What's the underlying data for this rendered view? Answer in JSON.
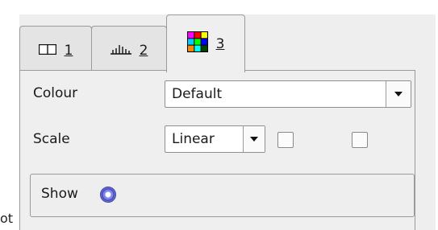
{
  "stray_text": "ot",
  "tabs": [
    {
      "label": "1",
      "icon": "panel-layout-icon"
    },
    {
      "label": "2",
      "icon": "histogram-icon"
    },
    {
      "label": "3",
      "icon": "color-grid-icon",
      "selected": true
    }
  ],
  "colour": {
    "label": "Colour",
    "value": "Default"
  },
  "scale": {
    "label": "Scale",
    "value": "Linear",
    "checkbox_1_checked": false,
    "checkbox_2_checked": false
  },
  "show": {
    "label": "Show",
    "selected": true
  },
  "colors": {
    "grid": [
      "#ff00ff",
      "#ff0000",
      "#ffff00",
      "#00ccff",
      "#00ff00",
      "#0000ff",
      "#ff8800",
      "#00ffff",
      "#004400"
    ]
  }
}
